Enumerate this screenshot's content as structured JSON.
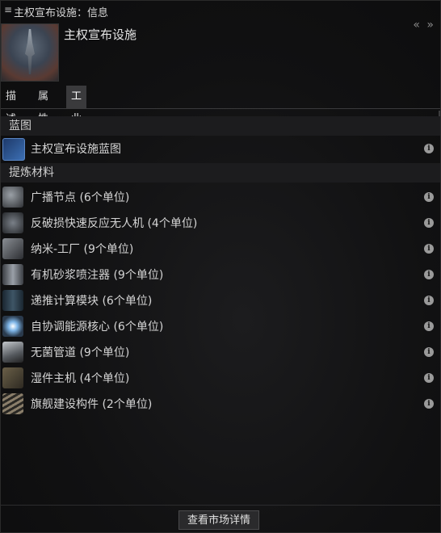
{
  "window": {
    "title": "主权宣布设施：信息",
    "menu_icon": "hamburger-icon",
    "collapse_icons": "« »"
  },
  "header": {
    "name": "主权宣布设施"
  },
  "tabs": [
    {
      "label": "描述",
      "active": false
    },
    {
      "label": "属性",
      "active": false
    },
    {
      "label": "工业",
      "active": true
    }
  ],
  "sections": {
    "blueprint": {
      "title": "蓝图",
      "items": [
        {
          "label": "主权宣布设施蓝图",
          "icon": "blueprint-icon"
        }
      ]
    },
    "materials": {
      "title": "提炼材料",
      "items": [
        {
          "label": "广播节点 (6个单位)",
          "icon": "broadcast-node-icon"
        },
        {
          "label": "反破损快速反应无人机 (4个单位)",
          "icon": "drone-icon"
        },
        {
          "label": "纳米-工厂 (9个单位)",
          "icon": "nano-factory-icon"
        },
        {
          "label": "有机砂浆喷注器 (9个单位)",
          "icon": "mortar-applicator-icon"
        },
        {
          "label": "递推计算模块 (6个单位)",
          "icon": "computing-module-icon"
        },
        {
          "label": "自协调能源核心 (6个单位)",
          "icon": "power-core-icon"
        },
        {
          "label": "无菌管道 (9个单位)",
          "icon": "conduit-icon"
        },
        {
          "label": "湿件主机 (4个单位)",
          "icon": "wetware-mainframe-icon"
        },
        {
          "label": "旗舰建设构件 (2个单位)",
          "icon": "construction-parts-icon"
        }
      ]
    }
  },
  "footer": {
    "market_button": "查看市场详情"
  },
  "info_glyph": "i"
}
